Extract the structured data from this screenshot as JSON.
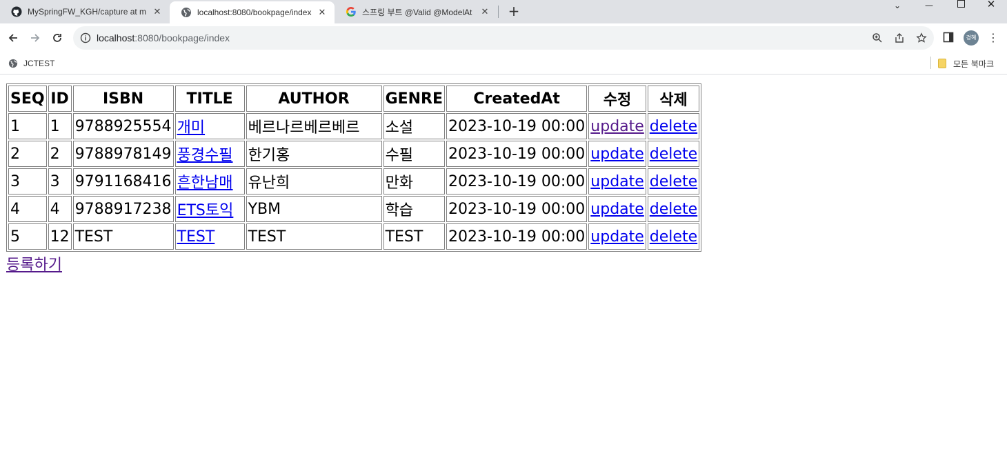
{
  "browser": {
    "tabs": [
      {
        "title": "MySpringFW_KGH/capture at m",
        "icon": "github-icon",
        "active": false
      },
      {
        "title": "localhost:8080/bookpage/index",
        "icon": "globe-icon",
        "active": true
      },
      {
        "title": "스프링 부트 @Valid @ModelAt",
        "icon": "google-icon",
        "active": false
      }
    ],
    "new_tab_label": "+",
    "url_host": "localhost",
    "url_rest": ":8080/bookpage/index",
    "profile_initials": "경혜",
    "bookmarks": [
      {
        "label": "JCTEST",
        "icon": "globe-icon"
      }
    ],
    "all_bookmarks_label": "모든 북마크"
  },
  "table": {
    "headers": [
      "SEQ",
      "ID",
      "ISBN",
      "TITLE",
      "AUTHOR",
      "GENRE",
      "CreatedAt",
      "수정",
      "삭제"
    ],
    "rows": [
      {
        "seq": "1",
        "id": "1",
        "isbn": "9788925554",
        "title": "개미",
        "author": "베르나르베르베르",
        "genre": "소설",
        "created_at": "2023-10-19 00:00",
        "update": "update",
        "delete": "delete"
      },
      {
        "seq": "2",
        "id": "2",
        "isbn": "9788978149",
        "title": "풍경수필",
        "author": "한기홍",
        "genre": "수필",
        "created_at": "2023-10-19 00:00",
        "update": "update",
        "delete": "delete"
      },
      {
        "seq": "3",
        "id": "3",
        "isbn": "9791168416",
        "title": "흔한남매",
        "author": "유난희",
        "genre": "만화",
        "created_at": "2023-10-19 00:00",
        "update": "update",
        "delete": "delete"
      },
      {
        "seq": "4",
        "id": "4",
        "isbn": "9788917238",
        "title": "ETS토익",
        "author": "YBM",
        "genre": "학습",
        "created_at": "2023-10-19 00:00",
        "update": "update",
        "delete": "delete"
      },
      {
        "seq": "5",
        "id": "12",
        "isbn": "TEST",
        "title": "TEST",
        "author": "TEST",
        "genre": "TEST",
        "created_at": "2023-10-19 00:00",
        "update": "update",
        "delete": "delete"
      }
    ]
  },
  "register_link": "등록하기",
  "colors": {
    "link": "#0000ee",
    "visited_link": "#551a8b",
    "tabstrip_bg": "#dfe1e5",
    "omnibox_bg": "#f1f3f4"
  }
}
